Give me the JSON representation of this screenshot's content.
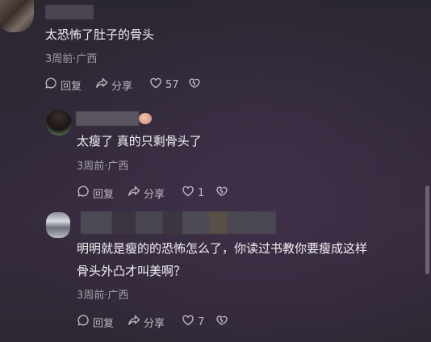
{
  "comments": [
    {
      "text": "太恐怖了肚子的骨头",
      "meta": "3周前·广西",
      "reply_label": "回复",
      "share_label": "分享",
      "like_count": "57"
    },
    {
      "text": "太瘦了 真的只剩骨头了",
      "meta": "3周前·广西",
      "reply_label": "回复",
      "share_label": "分享",
      "like_count": "1"
    },
    {
      "text_line1": "明明就是瘦的的恐怖怎么了，你读过书教你要瘦成这样",
      "text_line2": "骨头外凸才叫美啊？",
      "meta": "3周前·广西",
      "reply_label": "回复",
      "share_label": "分享",
      "like_count": "7"
    }
  ],
  "icons": {
    "reply": "reply-bubble-icon",
    "share": "share-arrow-icon",
    "like": "heart-icon",
    "dislike": "broken-heart-icon"
  },
  "colors": {
    "text": "#f4f0f4",
    "meta": "#a59fab",
    "action": "#bdb7c3"
  }
}
